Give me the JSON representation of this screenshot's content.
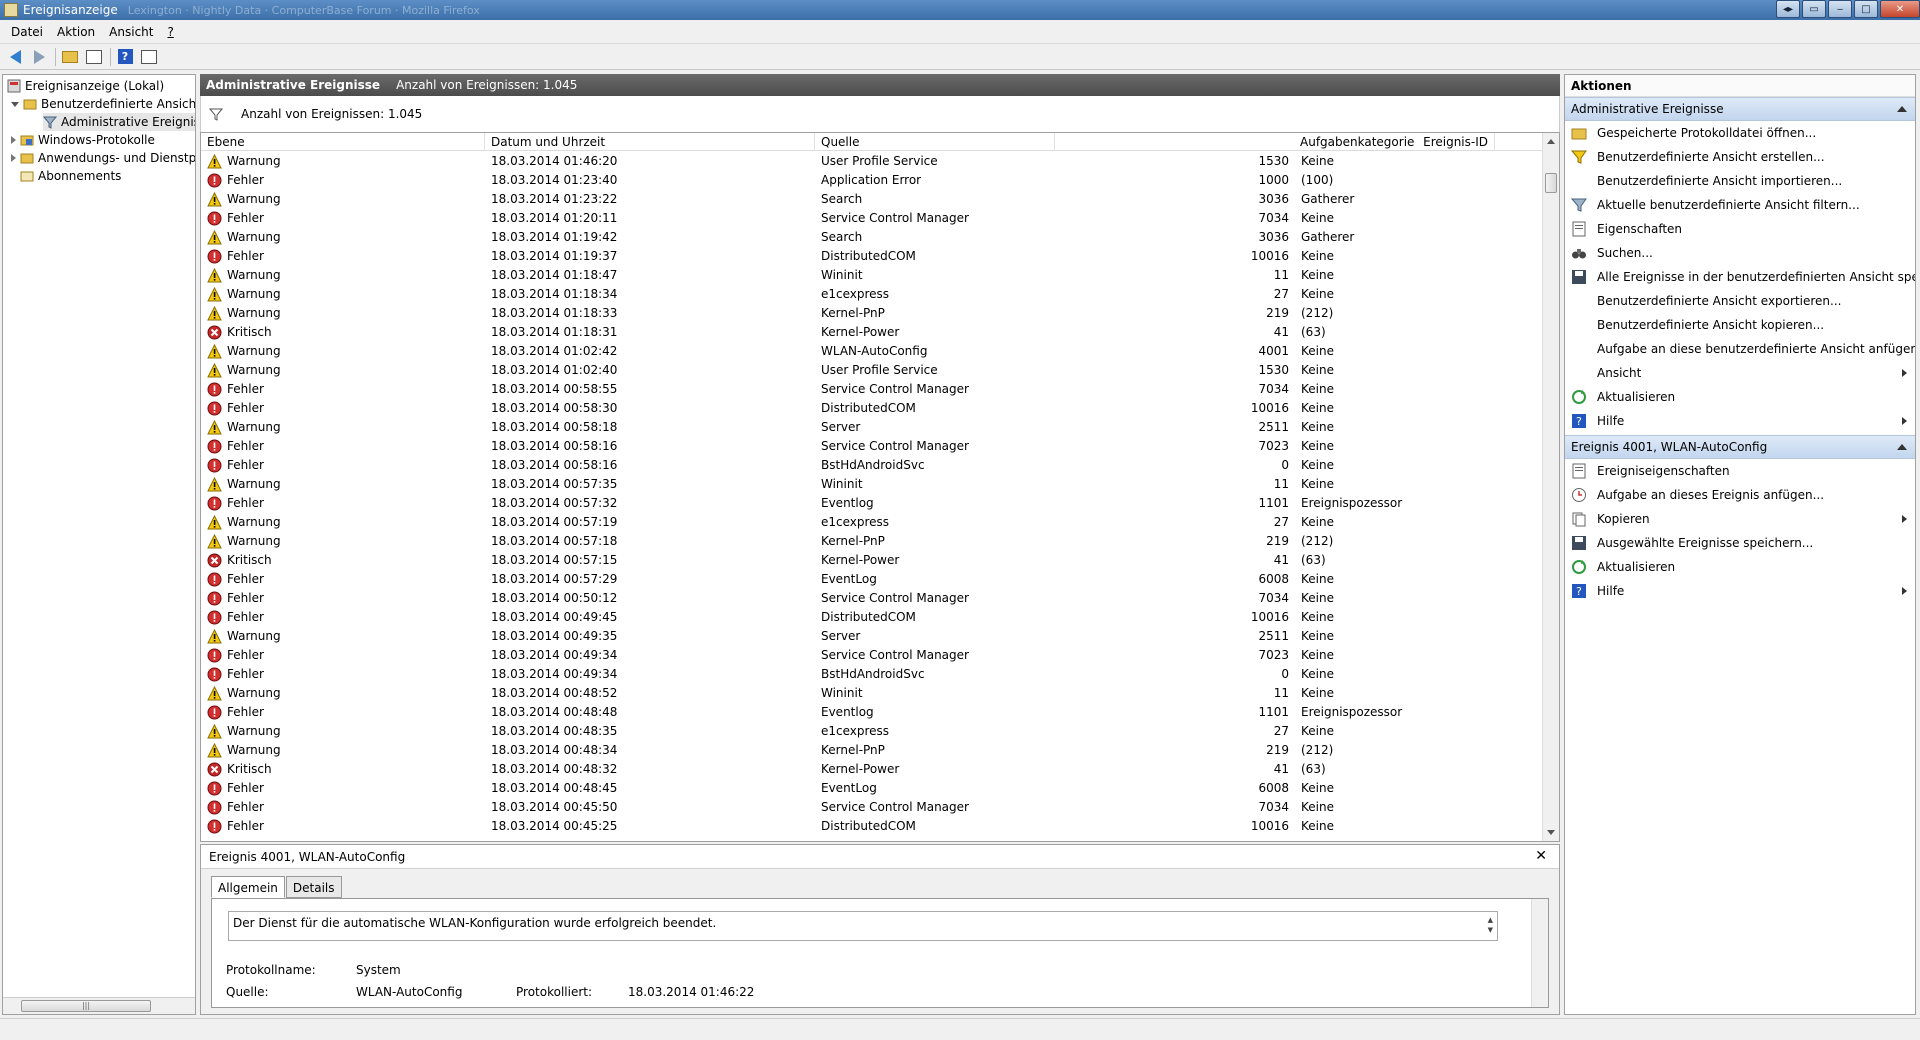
{
  "window": {
    "title": "Ereignisanzeige",
    "title_faint": "Lexington · Nightly Data · ComputerBase Forum · Mozilla Firefox"
  },
  "menu": [
    "Datei",
    "Aktion",
    "Ansicht",
    "?"
  ],
  "tree": {
    "root": "Ereignisanzeige (Lokal)",
    "custom_views": "Benutzerdefinierte Ansichten",
    "admin_events": "Administrative Ereignisse",
    "windows_logs": "Windows-Protokolle",
    "app_logs": "Anwendungs- und Dienstprotokolle",
    "subscriptions": "Abonnements"
  },
  "center": {
    "header_title": "Administrative Ereignisse",
    "header_count": "Anzahl von Ereignissen: 1.045",
    "filter_text": "Anzahl von Ereignissen: 1.045",
    "columns": [
      "Ebene",
      "Datum und Uhrzeit",
      "Quelle",
      "Ereignis-ID",
      "Aufgabenkategorie"
    ],
    "rows": [
      {
        "level": "Warnung",
        "type": "warn",
        "date": "18.03.2014 01:46:20",
        "source": "User Profile Service",
        "id": "1530",
        "cat": "Keine"
      },
      {
        "level": "Fehler",
        "type": "err",
        "date": "18.03.2014 01:23:40",
        "source": "Application Error",
        "id": "1000",
        "cat": "(100)"
      },
      {
        "level": "Warnung",
        "type": "warn",
        "date": "18.03.2014 01:23:22",
        "source": "Search",
        "id": "3036",
        "cat": "Gatherer"
      },
      {
        "level": "Fehler",
        "type": "err",
        "date": "18.03.2014 01:20:11",
        "source": "Service Control Manager",
        "id": "7034",
        "cat": "Keine"
      },
      {
        "level": "Warnung",
        "type": "warn",
        "date": "18.03.2014 01:19:42",
        "source": "Search",
        "id": "3036",
        "cat": "Gatherer"
      },
      {
        "level": "Fehler",
        "type": "err",
        "date": "18.03.2014 01:19:37",
        "source": "DistributedCOM",
        "id": "10016",
        "cat": "Keine"
      },
      {
        "level": "Warnung",
        "type": "warn",
        "date": "18.03.2014 01:18:47",
        "source": "Wininit",
        "id": "11",
        "cat": "Keine"
      },
      {
        "level": "Warnung",
        "type": "warn",
        "date": "18.03.2014 01:18:34",
        "source": "e1cexpress",
        "id": "27",
        "cat": "Keine"
      },
      {
        "level": "Warnung",
        "type": "warn",
        "date": "18.03.2014 01:18:33",
        "source": "Kernel-PnP",
        "id": "219",
        "cat": "(212)"
      },
      {
        "level": "Kritisch",
        "type": "crit",
        "date": "18.03.2014 01:18:31",
        "source": "Kernel-Power",
        "id": "41",
        "cat": "(63)"
      },
      {
        "level": "Warnung",
        "type": "warn",
        "date": "18.03.2014 01:02:42",
        "source": "WLAN-AutoConfig",
        "id": "4001",
        "cat": "Keine"
      },
      {
        "level": "Warnung",
        "type": "warn",
        "date": "18.03.2014 01:02:40",
        "source": "User Profile Service",
        "id": "1530",
        "cat": "Keine"
      },
      {
        "level": "Fehler",
        "type": "err",
        "date": "18.03.2014 00:58:55",
        "source": "Service Control Manager",
        "id": "7034",
        "cat": "Keine"
      },
      {
        "level": "Fehler",
        "type": "err",
        "date": "18.03.2014 00:58:30",
        "source": "DistributedCOM",
        "id": "10016",
        "cat": "Keine"
      },
      {
        "level": "Warnung",
        "type": "warn",
        "date": "18.03.2014 00:58:18",
        "source": "Server",
        "id": "2511",
        "cat": "Keine"
      },
      {
        "level": "Fehler",
        "type": "err",
        "date": "18.03.2014 00:58:16",
        "source": "Service Control Manager",
        "id": "7023",
        "cat": "Keine"
      },
      {
        "level": "Fehler",
        "type": "err",
        "date": "18.03.2014 00:58:16",
        "source": "BstHdAndroidSvc",
        "id": "0",
        "cat": "Keine"
      },
      {
        "level": "Warnung",
        "type": "warn",
        "date": "18.03.2014 00:57:35",
        "source": "Wininit",
        "id": "11",
        "cat": "Keine"
      },
      {
        "level": "Fehler",
        "type": "err",
        "date": "18.03.2014 00:57:32",
        "source": "Eventlog",
        "id": "1101",
        "cat": "Ereignispozessor"
      },
      {
        "level": "Warnung",
        "type": "warn",
        "date": "18.03.2014 00:57:19",
        "source": "e1cexpress",
        "id": "27",
        "cat": "Keine"
      },
      {
        "level": "Warnung",
        "type": "warn",
        "date": "18.03.2014 00:57:18",
        "source": "Kernel-PnP",
        "id": "219",
        "cat": "(212)"
      },
      {
        "level": "Kritisch",
        "type": "crit",
        "date": "18.03.2014 00:57:15",
        "source": "Kernel-Power",
        "id": "41",
        "cat": "(63)"
      },
      {
        "level": "Fehler",
        "type": "err",
        "date": "18.03.2014 00:57:29",
        "source": "EventLog",
        "id": "6008",
        "cat": "Keine"
      },
      {
        "level": "Fehler",
        "type": "err",
        "date": "18.03.2014 00:50:12",
        "source": "Service Control Manager",
        "id": "7034",
        "cat": "Keine"
      },
      {
        "level": "Fehler",
        "type": "err",
        "date": "18.03.2014 00:49:45",
        "source": "DistributedCOM",
        "id": "10016",
        "cat": "Keine"
      },
      {
        "level": "Warnung",
        "type": "warn",
        "date": "18.03.2014 00:49:35",
        "source": "Server",
        "id": "2511",
        "cat": "Keine"
      },
      {
        "level": "Fehler",
        "type": "err",
        "date": "18.03.2014 00:49:34",
        "source": "Service Control Manager",
        "id": "7023",
        "cat": "Keine"
      },
      {
        "level": "Fehler",
        "type": "err",
        "date": "18.03.2014 00:49:34",
        "source": "BstHdAndroidSvc",
        "id": "0",
        "cat": "Keine"
      },
      {
        "level": "Warnung",
        "type": "warn",
        "date": "18.03.2014 00:48:52",
        "source": "Wininit",
        "id": "11",
        "cat": "Keine"
      },
      {
        "level": "Fehler",
        "type": "err",
        "date": "18.03.2014 00:48:48",
        "source": "Eventlog",
        "id": "1101",
        "cat": "Ereignispozessor"
      },
      {
        "level": "Warnung",
        "type": "warn",
        "date": "18.03.2014 00:48:35",
        "source": "e1cexpress",
        "id": "27",
        "cat": "Keine"
      },
      {
        "level": "Warnung",
        "type": "warn",
        "date": "18.03.2014 00:48:34",
        "source": "Kernel-PnP",
        "id": "219",
        "cat": "(212)"
      },
      {
        "level": "Kritisch",
        "type": "crit",
        "date": "18.03.2014 00:48:32",
        "source": "Kernel-Power",
        "id": "41",
        "cat": "(63)"
      },
      {
        "level": "Fehler",
        "type": "err",
        "date": "18.03.2014 00:48:45",
        "source": "EventLog",
        "id": "6008",
        "cat": "Keine"
      },
      {
        "level": "Fehler",
        "type": "err",
        "date": "18.03.2014 00:45:50",
        "source": "Service Control Manager",
        "id": "7034",
        "cat": "Keine"
      },
      {
        "level": "Fehler",
        "type": "err",
        "date": "18.03.2014 00:45:25",
        "source": "DistributedCOM",
        "id": "10016",
        "cat": "Keine"
      }
    ]
  },
  "detail": {
    "title": "Ereignis 4001, WLAN-AutoConfig",
    "close": "✕",
    "tabs": [
      "Allgemein",
      "Details"
    ],
    "description": "Der Dienst für die automatische WLAN-Konfiguration wurde erfolgreich beendet.",
    "log_name_label": "Protokollname:",
    "log_name_value": "System",
    "source_label": "Quelle:",
    "source_value": "WLAN-AutoConfig",
    "logged_label": "Protokolliert:",
    "logged_value": "18.03.2014 01:46:22"
  },
  "actions": {
    "title": "Aktionen",
    "section1_title": "Administrative Ereignisse",
    "section1_items": [
      {
        "label": "Gespeicherte Protokolldatei öffnen...",
        "icon": "open-folder-icon",
        "sub": false
      },
      {
        "label": "Benutzerdefinierte Ansicht erstellen...",
        "icon": "create-filter-icon",
        "sub": false
      },
      {
        "label": "Benutzerdefinierte Ansicht importieren...",
        "icon": "",
        "sub": false
      },
      {
        "label": "Aktuelle benutzerdefinierte Ansicht filtern...",
        "icon": "filter-icon",
        "sub": false
      },
      {
        "label": "Eigenschaften",
        "icon": "properties-icon",
        "sub": false
      },
      {
        "label": "Suchen...",
        "icon": "binoculars-icon",
        "sub": false
      },
      {
        "label": "Alle Ereignisse in der benutzerdefinierten Ansicht speic...",
        "icon": "save-icon",
        "sub": false
      },
      {
        "label": "Benutzerdefinierte Ansicht exportieren...",
        "icon": "",
        "sub": false
      },
      {
        "label": "Benutzerdefinierte Ansicht kopieren...",
        "icon": "",
        "sub": false
      },
      {
        "label": "Aufgabe an diese benutzerdefinierte Ansicht anfügen...",
        "icon": "",
        "sub": false
      },
      {
        "label": "Ansicht",
        "icon": "",
        "sub": true
      },
      {
        "label": "Aktualisieren",
        "icon": "refresh-icon",
        "sub": false
      },
      {
        "label": "Hilfe",
        "icon": "help-icon",
        "sub": true
      }
    ],
    "section2_title": "Ereignis 4001, WLAN-AutoConfig",
    "section2_items": [
      {
        "label": "Ereigniseigenschaften",
        "icon": "properties-icon",
        "sub": false
      },
      {
        "label": "Aufgabe an dieses Ereignis anfügen...",
        "icon": "task-icon",
        "sub": false
      },
      {
        "label": "Kopieren",
        "icon": "copy-icon",
        "sub": true
      },
      {
        "label": "Ausgewählte Ereignisse speichern...",
        "icon": "save-icon",
        "sub": false
      },
      {
        "label": "Aktualisieren",
        "icon": "refresh-icon",
        "sub": false
      },
      {
        "label": "Hilfe",
        "icon": "help-icon",
        "sub": true
      }
    ]
  }
}
